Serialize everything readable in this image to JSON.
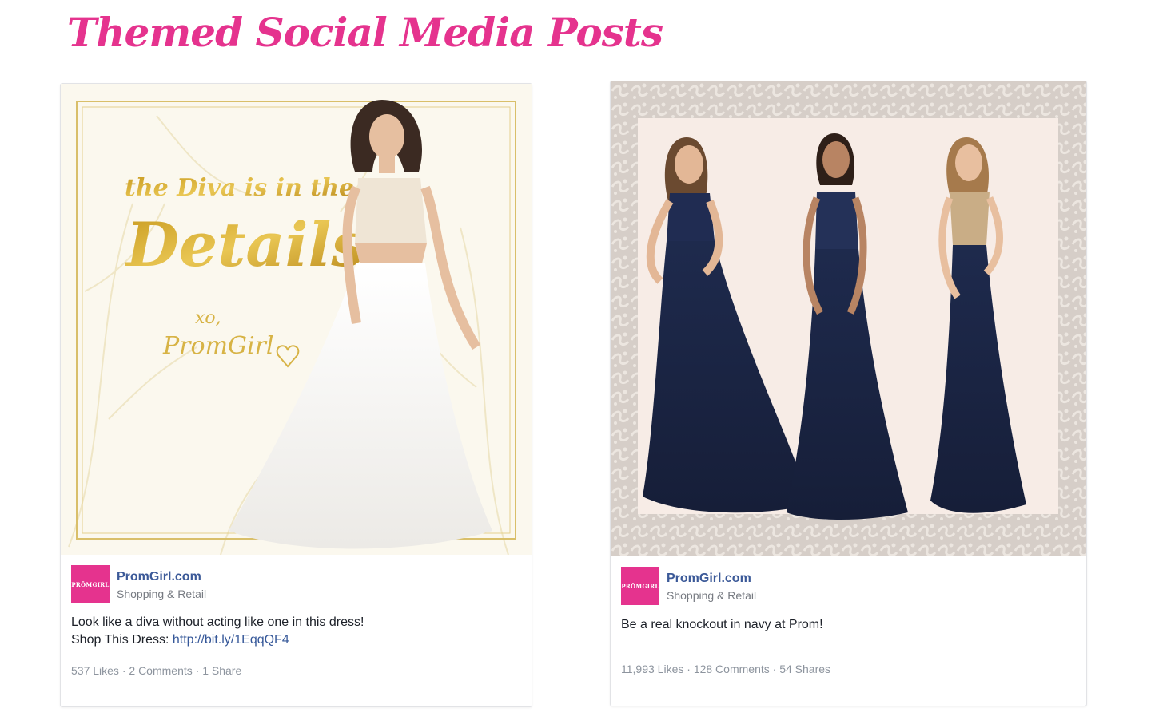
{
  "heading": {
    "text": "Themed Social Media Posts",
    "color": "#e5338e"
  },
  "posts": [
    {
      "image": {
        "title_line1": "the Diva is in the",
        "title_line2": "Details",
        "signoff": "xo,",
        "signature": "PromGirl"
      },
      "page_name": "PromGirl.com",
      "logo_text": "PRŌMGIRL",
      "category": "Shopping & Retail",
      "text_line1": "Look like a diva without acting like one in this dress!",
      "text_line2_prefix": "Shop This Dress: ",
      "link": "http://bit.ly/1EqqQF4",
      "likes": "537 Likes",
      "comments": "2 Comments",
      "shares": "1 Share"
    },
    {
      "page_name": "PromGirl.com",
      "logo_text": "PRŌMGIRL",
      "category": "Shopping & Retail",
      "text_line1": "Be a real knockout in navy at Prom!",
      "likes": "11,993 Likes",
      "comments": "128 Comments",
      "shares": "54 Shares"
    }
  ],
  "separator": " · "
}
